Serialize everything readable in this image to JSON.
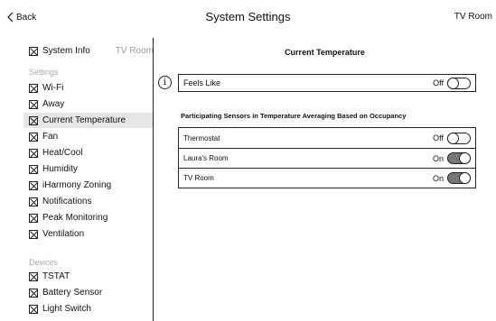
{
  "header": {
    "back_label": "Back",
    "title": "System Settings",
    "room": "TV Room"
  },
  "sidebar": {
    "top_item": {
      "label": "System Info",
      "tag": "TV Room"
    },
    "settings_heading": "Settings",
    "settings_items": [
      {
        "label": "Wi-Fi"
      },
      {
        "label": "Away"
      },
      {
        "label": "Current Temperature"
      },
      {
        "label": "Fan"
      },
      {
        "label": "Heat/Cool"
      },
      {
        "label": "Humidity"
      },
      {
        "label": "iHarmony Zoning"
      },
      {
        "label": "Notifications"
      },
      {
        "label": "Peak Monitoring"
      },
      {
        "label": "Ventilation"
      }
    ],
    "devices_heading": "Devices",
    "device_items": [
      {
        "label": "TSTAT"
      },
      {
        "label": "Battery Sensor"
      },
      {
        "label": "Light Switch"
      }
    ]
  },
  "main": {
    "section_title": "Current Temperature",
    "info_icon_glyph": "i",
    "feels_like": {
      "label": "Feels Like",
      "state": "Off"
    },
    "sensors_heading": "Participating Sensors in Temperature Averaging Based on Occupancy",
    "sensors": [
      {
        "label": "Thermostat",
        "state": "Off"
      },
      {
        "label": "Laura's Room",
        "state": "On"
      },
      {
        "label": "TV Room",
        "state": "On"
      }
    ]
  }
}
